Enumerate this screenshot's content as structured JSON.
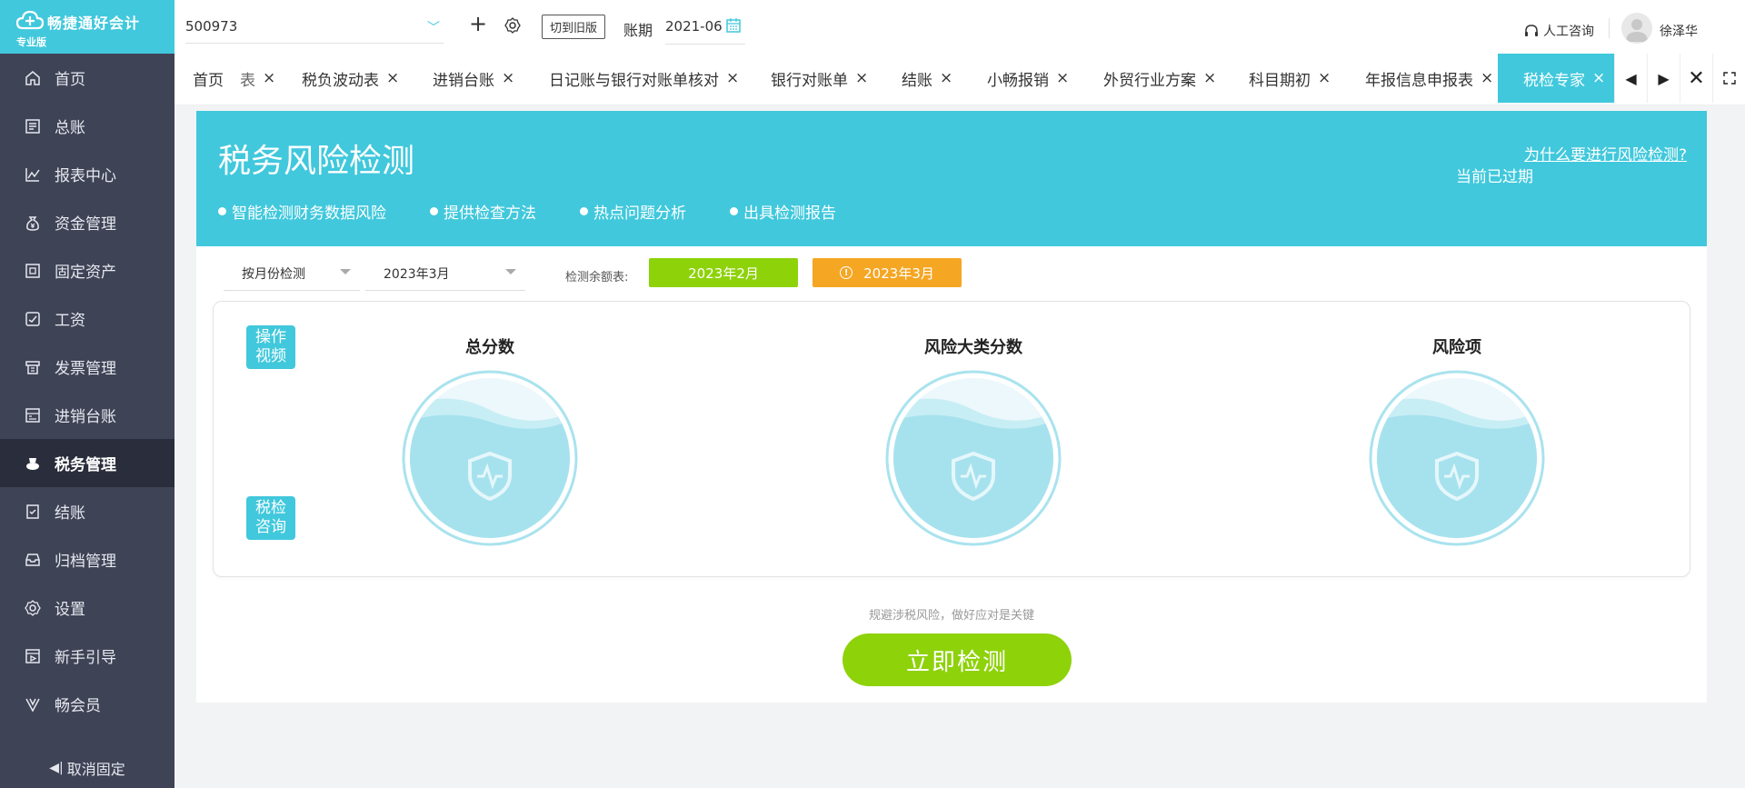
{
  "app": {
    "name": "畅捷通好会计",
    "edition": "专业版"
  },
  "sidebar": {
    "items": [
      {
        "label": "首页",
        "icon": "home-icon"
      },
      {
        "label": "总账",
        "icon": "ledger-icon"
      },
      {
        "label": "报表中心",
        "icon": "chart-icon"
      },
      {
        "label": "资金管理",
        "icon": "money-bag-icon"
      },
      {
        "label": "固定资产",
        "icon": "asset-icon"
      },
      {
        "label": "工资",
        "icon": "salary-icon"
      },
      {
        "label": "发票管理",
        "icon": "invoice-icon"
      },
      {
        "label": "进销台账",
        "icon": "inventory-icon"
      },
      {
        "label": "税务管理",
        "icon": "tax-icon",
        "active": true
      },
      {
        "label": "结账",
        "icon": "closing-icon"
      },
      {
        "label": "归档管理",
        "icon": "archive-icon"
      },
      {
        "label": "设置",
        "icon": "gear-icon"
      },
      {
        "label": "新手引导",
        "icon": "guide-icon"
      },
      {
        "label": "畅会员",
        "icon": "vip-icon"
      }
    ],
    "unpin_label": "取消固定"
  },
  "topbar": {
    "company": "500973",
    "old_version_label": "切到旧版",
    "period_label": "账期",
    "period_value": "2021-06",
    "help_label": "人工咨询",
    "username": "徐泽华"
  },
  "tabs": [
    {
      "label": "首页"
    },
    {
      "label": "表"
    },
    {
      "label": "税负波动表"
    },
    {
      "label": "进销台账"
    },
    {
      "label": "日记账与银行对账单核对"
    },
    {
      "label": "银行对账单"
    },
    {
      "label": "结账"
    },
    {
      "label": "小畅报销"
    },
    {
      "label": "外贸行业方案"
    },
    {
      "label": "科目期初"
    },
    {
      "label": "年报信息申报表"
    },
    {
      "label": "税检专家",
      "active": true
    }
  ],
  "banner": {
    "title": "税务风险检测",
    "features": [
      "智能检测财务数据风险",
      "提供检查方法",
      "热点问题分析",
      "出具检测报告"
    ],
    "why_link": "为什么要进行风险检测?",
    "status": "当前已过期"
  },
  "filters": {
    "mode": "按月份检测",
    "month": "2023年3月",
    "remaining_label": "检测余额表:",
    "month_buttons": [
      "2023年2月",
      "2023年3月"
    ]
  },
  "panel": {
    "side_tags": [
      "操作\n视频",
      "税检\n咨询"
    ],
    "gauges": [
      "总分数",
      "风险大类分数",
      "风险项"
    ]
  },
  "hint": "规避涉税风险，做好应对是关键",
  "detect_button": "立即检测",
  "colors": {
    "brand": "#41c8dc",
    "sidebar": "#3f4356",
    "sidebar_active": "#2a2d3b",
    "green": "#8ed20a",
    "orange": "#f5a623"
  }
}
